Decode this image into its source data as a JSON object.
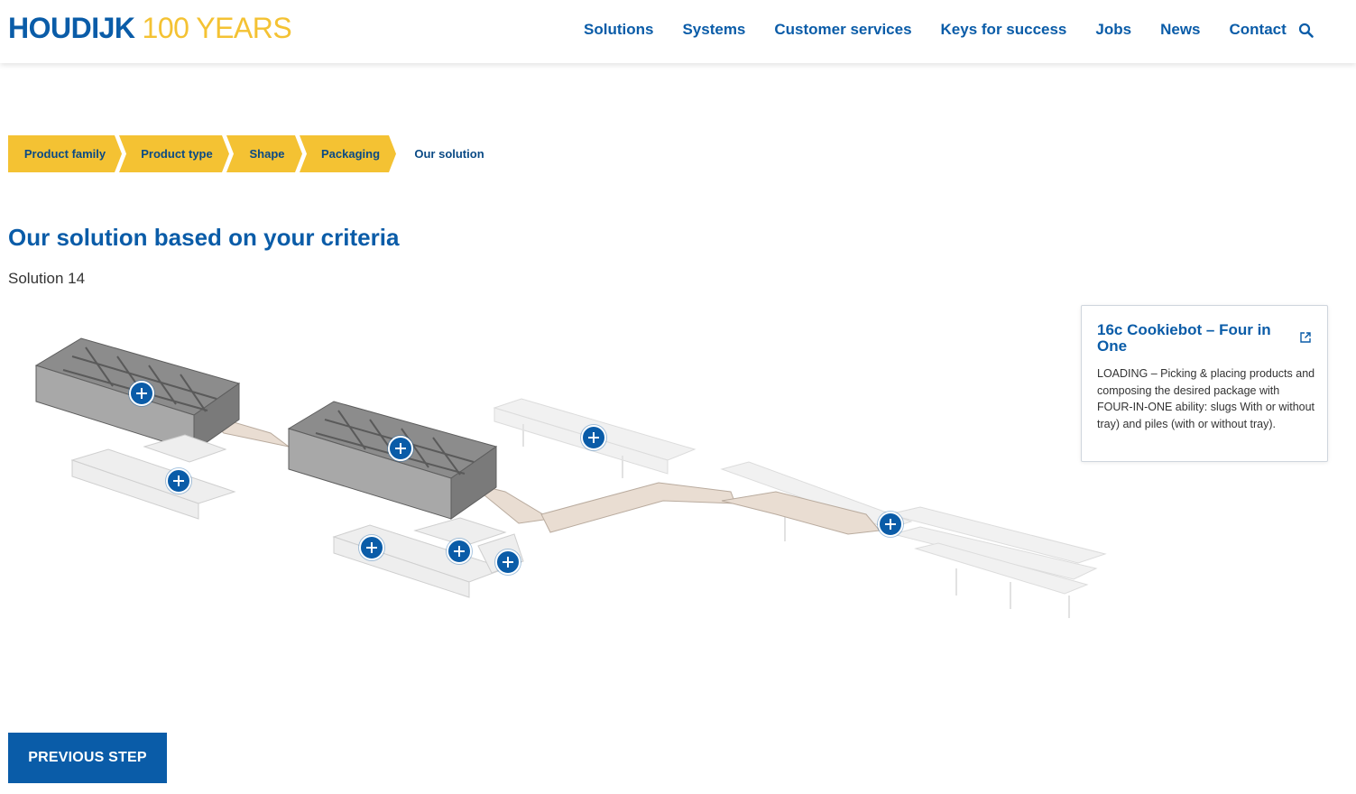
{
  "header": {
    "brand": "HOUDIJK",
    "brand_suffix": "100 YEARS",
    "nav": [
      "Solutions",
      "Systems",
      "Customer services",
      "Keys for success",
      "Jobs",
      "News",
      "Contact"
    ]
  },
  "steps": [
    "Product family",
    "Product type",
    "Shape",
    "Packaging",
    "Our solution"
  ],
  "main": {
    "title": "Our solution based on your criteria",
    "subtitle": "Solution 14"
  },
  "card": {
    "title": "16c Cookiebot – Four in One",
    "description": "LOADING – Picking & placing products and composing the desired package with FOUR-IN-ONE ability: slugs With or without tray) and piles (with or without tray)."
  },
  "buttons": {
    "previous": "PREVIOUS STEP"
  },
  "colors": {
    "brand_blue": "#0a5ca8",
    "accent_yellow": "#f4c233"
  }
}
